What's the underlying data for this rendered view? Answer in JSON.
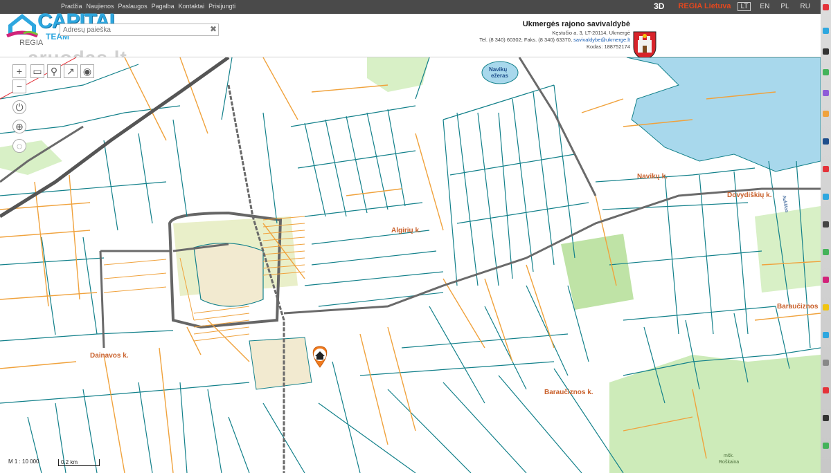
{
  "topbar": {
    "menu": [
      "Pradžia",
      "Naujienos",
      "Paslaugos",
      "Pagalba",
      "Kontaktai",
      "Prisijungti"
    ],
    "btn_3d": "3D",
    "regia": "REGIA Lietuva",
    "languages": [
      "LT",
      "EN",
      "PL",
      "RU"
    ]
  },
  "header": {
    "logo_word": "CAPITAL",
    "logo_team": "TEAM",
    "regia_label": "REGIA",
    "watermark": "aruodas.lt",
    "search_placeholder": "Adresų paieška",
    "search_clear": "✖"
  },
  "municipality": {
    "name": "Ukmergės rajono savivaldybė",
    "address": "Kęstučio a. 3, LT-20114, Ukmergė",
    "phone": "Tel. (8 340) 60302; Faks. (8 340) 63370,",
    "email": "savivaldybe@ukmerge.lt",
    "code": "Kodas: 188752174"
  },
  "map": {
    "labels": {
      "navikai_lake": [
        "Navikų",
        "ežeras"
      ],
      "navikai_village": "Navikų k.",
      "algiriai": "Algirių k.",
      "dovydiskiai": "Dovydiškių k.",
      "dainavos": "Dainavos k.",
      "baraucizinos_1": "Baraučiznos k.",
      "baraucizinos_2": "Baraučiznos",
      "forest": [
        "mšk.",
        "Roškaina"
      ],
      "road": "Aukštas"
    },
    "scale": "M 1 : 10 000",
    "scalebar": "0.2 km",
    "colors": {
      "cadastral": "#12808a",
      "orange_parcel": "#f0a23c",
      "road": "#6a6a6a",
      "water": "#a8d8ec",
      "forest": "#cdebb9"
    }
  }
}
